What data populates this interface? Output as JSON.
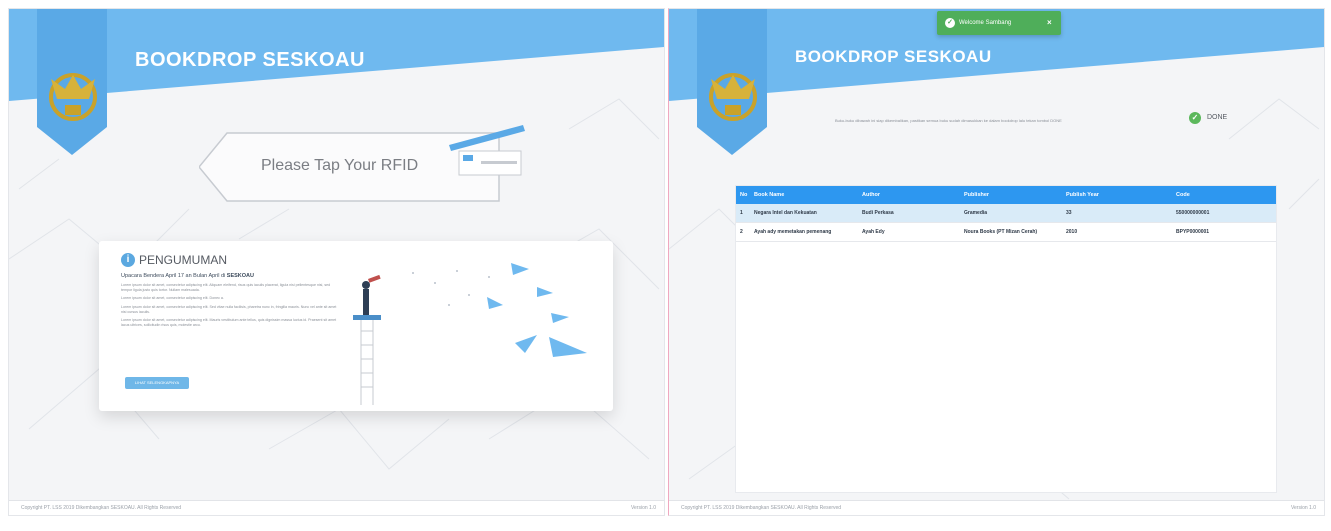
{
  "app_title": "BOOKDROP SESKOAU",
  "footer": {
    "copyright": "Copyright PT. LSS 2019 Dikembangkan SESKOAU. All Rights Reserved",
    "version": "Version 1.0"
  },
  "login_screen": {
    "prompt": "Please Tap Your RFID",
    "announcement": {
      "title": "PENGUMUMAN",
      "subtitle_prefix": "Upacara Bendera April 17 an Bulan April di",
      "subtitle_emphasis": "SESKOAU",
      "paragraphs": [
        "Lorem ipsum dolor sit amet, consectetur adipiscing elit. Aliquam eleifend, risus quis iaculis placerat, ligula nisi pellentesque nisi, sed tempor ligula justo quis tortor. Nullam malesuada.",
        "Lorem ipsum dolor sit amet, consectetur adipiscing elit. Donec a.",
        "Lorem ipsum dolor sit amet, consectetur adipiscing elit. Sed vitae nulla facilisis, pharetra nunc in, fringilla mauris. Nunc vel ante sit amet nisi cursus iaculis.",
        "Lorem ipsum dolor sit amet, consectetur adipiscing elit. Mauris vestibulum ante tellus, quis dignissim massa luctus id. Praesent sit amet lacus ultrices, sollicitudin risus quis, molestie arcu."
      ],
      "button_label": "LIHAT SELENGKAPNYA"
    }
  },
  "return_screen": {
    "toast": {
      "message": "Welcome Sambang",
      "close": "×"
    },
    "notice": "Buku-buku dibawah ini siap dikembalikan, pastikan semua buku sudah dimasukkan ke dalam bookdrop lalu tekan tombol DONE",
    "done_label": "DONE",
    "columns": [
      "No",
      "Book Name",
      "Author",
      "Publisher",
      "Publish Year",
      "Code"
    ],
    "rows": [
      {
        "no": "1",
        "book_name": "Negara Intel dan Kekuatan",
        "author": "Budi Perkasa",
        "publisher": "Gramedia",
        "year": "33",
        "code": "550000000001"
      },
      {
        "no": "2",
        "book_name": "Ayah ady memetakan pemenang",
        "author": "Ayah Edy",
        "publisher": "Noura Books (PT Mizan Cerah)",
        "year": "2010",
        "code": "BPYP0000001"
      }
    ]
  },
  "colors": {
    "banner_blue": "#6fb9ef",
    "table_header": "#2d97f0",
    "toast_green": "#4fae5a",
    "emblem_gold": "#c9a22a"
  }
}
